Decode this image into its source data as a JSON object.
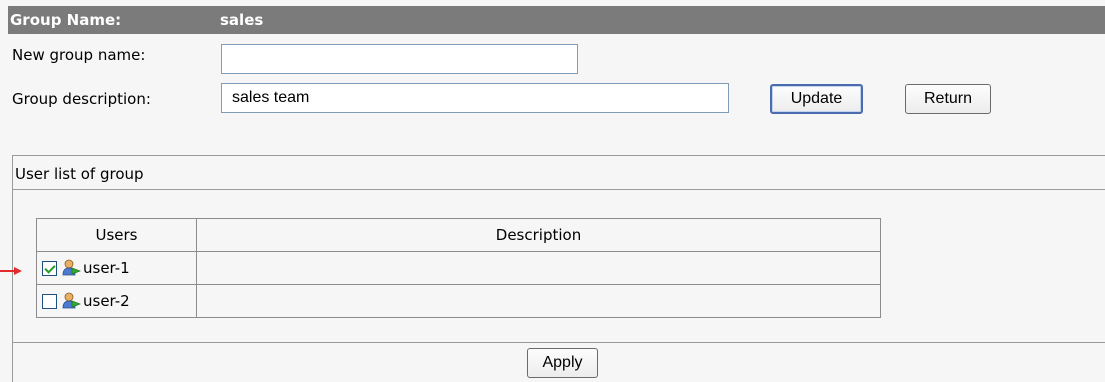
{
  "header": {
    "label": "Group Name:",
    "value": "sales"
  },
  "form": {
    "new_name_label": "New group name:",
    "new_name_value": "",
    "description_label": "Group description:",
    "description_value": "sales team"
  },
  "buttons": {
    "update": "Update",
    "return": "Return",
    "apply": "Apply"
  },
  "user_section": {
    "title": "User list of group",
    "columns": [
      "Users",
      "Description"
    ],
    "rows": [
      {
        "name": "user-1",
        "checked": true,
        "description": ""
      },
      {
        "name": "user-2",
        "checked": false,
        "description": ""
      }
    ]
  },
  "colors": {
    "header_bg": "#7b7b7b",
    "marker": "#e32b2b",
    "checkmark": "#21a121"
  }
}
